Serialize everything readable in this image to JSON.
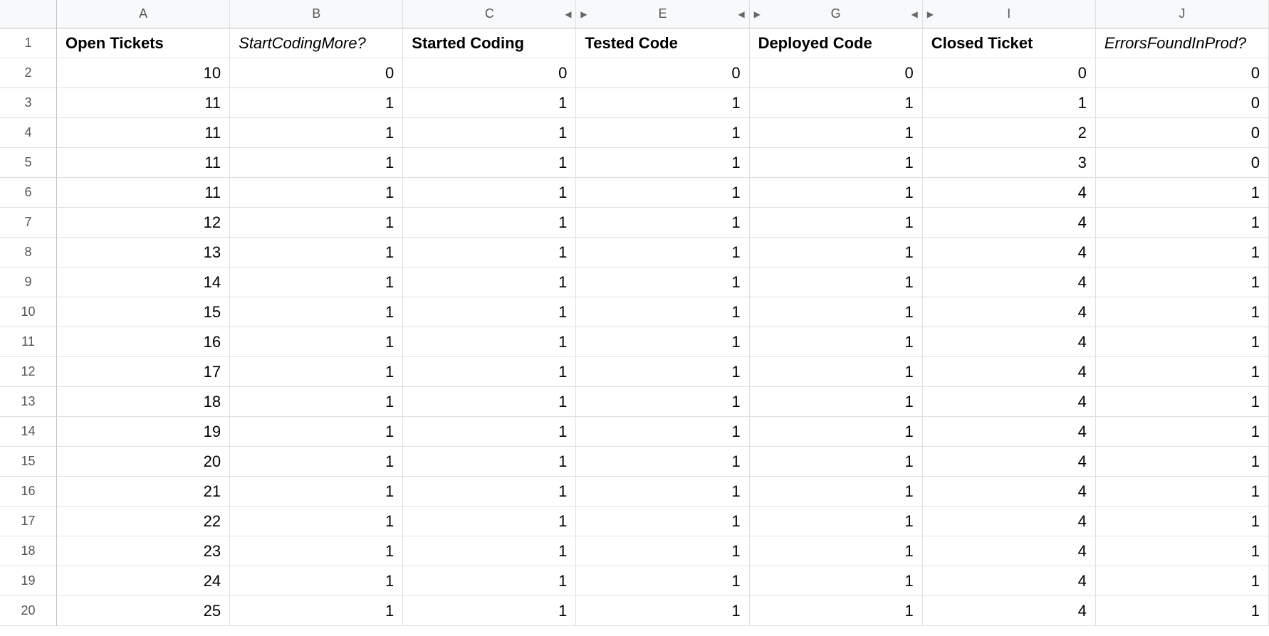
{
  "columns": [
    "A",
    "B",
    "C",
    "E",
    "G",
    "I",
    "J"
  ],
  "collapsedGroups": [
    {
      "index": 2,
      "side": "right"
    },
    {
      "index": 3,
      "side": "both"
    },
    {
      "index": 4,
      "side": "both"
    },
    {
      "index": 5,
      "side": "left"
    }
  ],
  "headers": [
    {
      "text": "Open Tickets",
      "style": "bold"
    },
    {
      "text": "StartCodingMore?",
      "style": "italic"
    },
    {
      "text": "Started Coding",
      "style": "bold"
    },
    {
      "text": "Tested Code",
      "style": "bold"
    },
    {
      "text": "Deployed Code",
      "style": "bold"
    },
    {
      "text": "Closed Ticket",
      "style": "bold"
    },
    {
      "text": "ErrorsFoundInProd?",
      "style": "italic"
    }
  ],
  "rows": [
    [
      10,
      0,
      0,
      0,
      0,
      0,
      0
    ],
    [
      11,
      1,
      1,
      1,
      1,
      1,
      0
    ],
    [
      11,
      1,
      1,
      1,
      1,
      2,
      0
    ],
    [
      11,
      1,
      1,
      1,
      1,
      3,
      0
    ],
    [
      11,
      1,
      1,
      1,
      1,
      4,
      1
    ],
    [
      12,
      1,
      1,
      1,
      1,
      4,
      1
    ],
    [
      13,
      1,
      1,
      1,
      1,
      4,
      1
    ],
    [
      14,
      1,
      1,
      1,
      1,
      4,
      1
    ],
    [
      15,
      1,
      1,
      1,
      1,
      4,
      1
    ],
    [
      16,
      1,
      1,
      1,
      1,
      4,
      1
    ],
    [
      17,
      1,
      1,
      1,
      1,
      4,
      1
    ],
    [
      18,
      1,
      1,
      1,
      1,
      4,
      1
    ],
    [
      19,
      1,
      1,
      1,
      1,
      4,
      1
    ],
    [
      20,
      1,
      1,
      1,
      1,
      4,
      1
    ],
    [
      21,
      1,
      1,
      1,
      1,
      4,
      1
    ],
    [
      22,
      1,
      1,
      1,
      1,
      4,
      1
    ],
    [
      23,
      1,
      1,
      1,
      1,
      4,
      1
    ],
    [
      24,
      1,
      1,
      1,
      1,
      4,
      1
    ],
    [
      25,
      1,
      1,
      1,
      1,
      4,
      1
    ]
  ]
}
